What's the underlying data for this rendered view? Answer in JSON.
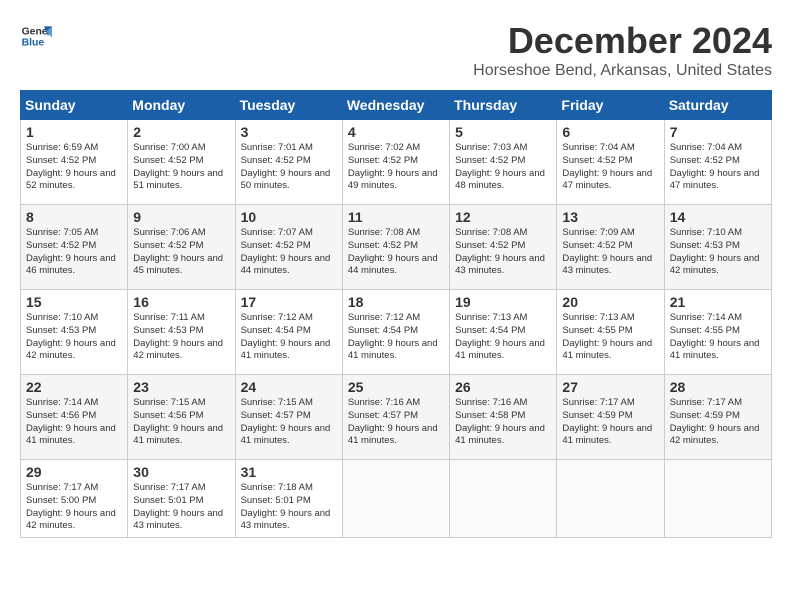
{
  "logo": {
    "line1": "General",
    "line2": "Blue"
  },
  "title": "December 2024",
  "subtitle": "Horseshoe Bend, Arkansas, United States",
  "headers": [
    "Sunday",
    "Monday",
    "Tuesday",
    "Wednesday",
    "Thursday",
    "Friday",
    "Saturday"
  ],
  "weeks": [
    [
      {
        "day": "1",
        "sunrise": "6:59 AM",
        "sunset": "4:52 PM",
        "daylight": "9 hours and 52 minutes."
      },
      {
        "day": "2",
        "sunrise": "7:00 AM",
        "sunset": "4:52 PM",
        "daylight": "9 hours and 51 minutes."
      },
      {
        "day": "3",
        "sunrise": "7:01 AM",
        "sunset": "4:52 PM",
        "daylight": "9 hours and 50 minutes."
      },
      {
        "day": "4",
        "sunrise": "7:02 AM",
        "sunset": "4:52 PM",
        "daylight": "9 hours and 49 minutes."
      },
      {
        "day": "5",
        "sunrise": "7:03 AM",
        "sunset": "4:52 PM",
        "daylight": "9 hours and 48 minutes."
      },
      {
        "day": "6",
        "sunrise": "7:04 AM",
        "sunset": "4:52 PM",
        "daylight": "9 hours and 47 minutes."
      },
      {
        "day": "7",
        "sunrise": "7:04 AM",
        "sunset": "4:52 PM",
        "daylight": "9 hours and 47 minutes."
      }
    ],
    [
      {
        "day": "8",
        "sunrise": "7:05 AM",
        "sunset": "4:52 PM",
        "daylight": "9 hours and 46 minutes."
      },
      {
        "day": "9",
        "sunrise": "7:06 AM",
        "sunset": "4:52 PM",
        "daylight": "9 hours and 45 minutes."
      },
      {
        "day": "10",
        "sunrise": "7:07 AM",
        "sunset": "4:52 PM",
        "daylight": "9 hours and 44 minutes."
      },
      {
        "day": "11",
        "sunrise": "7:08 AM",
        "sunset": "4:52 PM",
        "daylight": "9 hours and 44 minutes."
      },
      {
        "day": "12",
        "sunrise": "7:08 AM",
        "sunset": "4:52 PM",
        "daylight": "9 hours and 43 minutes."
      },
      {
        "day": "13",
        "sunrise": "7:09 AM",
        "sunset": "4:52 PM",
        "daylight": "9 hours and 43 minutes."
      },
      {
        "day": "14",
        "sunrise": "7:10 AM",
        "sunset": "4:53 PM",
        "daylight": "9 hours and 42 minutes."
      }
    ],
    [
      {
        "day": "15",
        "sunrise": "7:10 AM",
        "sunset": "4:53 PM",
        "daylight": "9 hours and 42 minutes."
      },
      {
        "day": "16",
        "sunrise": "7:11 AM",
        "sunset": "4:53 PM",
        "daylight": "9 hours and 42 minutes."
      },
      {
        "day": "17",
        "sunrise": "7:12 AM",
        "sunset": "4:54 PM",
        "daylight": "9 hours and 41 minutes."
      },
      {
        "day": "18",
        "sunrise": "7:12 AM",
        "sunset": "4:54 PM",
        "daylight": "9 hours and 41 minutes."
      },
      {
        "day": "19",
        "sunrise": "7:13 AM",
        "sunset": "4:54 PM",
        "daylight": "9 hours and 41 minutes."
      },
      {
        "day": "20",
        "sunrise": "7:13 AM",
        "sunset": "4:55 PM",
        "daylight": "9 hours and 41 minutes."
      },
      {
        "day": "21",
        "sunrise": "7:14 AM",
        "sunset": "4:55 PM",
        "daylight": "9 hours and 41 minutes."
      }
    ],
    [
      {
        "day": "22",
        "sunrise": "7:14 AM",
        "sunset": "4:56 PM",
        "daylight": "9 hours and 41 minutes."
      },
      {
        "day": "23",
        "sunrise": "7:15 AM",
        "sunset": "4:56 PM",
        "daylight": "9 hours and 41 minutes."
      },
      {
        "day": "24",
        "sunrise": "7:15 AM",
        "sunset": "4:57 PM",
        "daylight": "9 hours and 41 minutes."
      },
      {
        "day": "25",
        "sunrise": "7:16 AM",
        "sunset": "4:57 PM",
        "daylight": "9 hours and 41 minutes."
      },
      {
        "day": "26",
        "sunrise": "7:16 AM",
        "sunset": "4:58 PM",
        "daylight": "9 hours and 41 minutes."
      },
      {
        "day": "27",
        "sunrise": "7:17 AM",
        "sunset": "4:59 PM",
        "daylight": "9 hours and 41 minutes."
      },
      {
        "day": "28",
        "sunrise": "7:17 AM",
        "sunset": "4:59 PM",
        "daylight": "9 hours and 42 minutes."
      }
    ],
    [
      {
        "day": "29",
        "sunrise": "7:17 AM",
        "sunset": "5:00 PM",
        "daylight": "9 hours and 42 minutes."
      },
      {
        "day": "30",
        "sunrise": "7:17 AM",
        "sunset": "5:01 PM",
        "daylight": "9 hours and 43 minutes."
      },
      {
        "day": "31",
        "sunrise": "7:18 AM",
        "sunset": "5:01 PM",
        "daylight": "9 hours and 43 minutes."
      },
      null,
      null,
      null,
      null
    ]
  ]
}
